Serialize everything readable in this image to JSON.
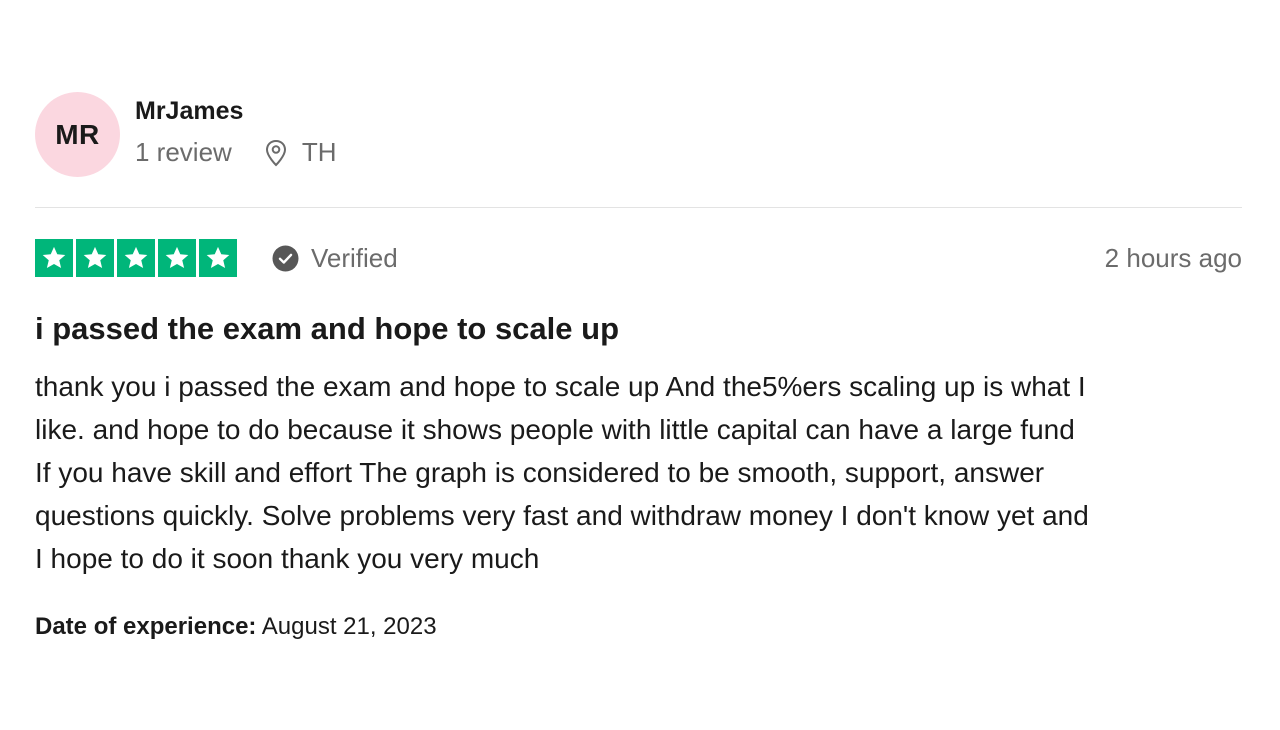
{
  "reviewer": {
    "initials": "MR",
    "avatar_color": "#fbd7e0",
    "name": "MrJames",
    "review_count": "1 review",
    "location_icon": "location-pin-icon",
    "country": "TH"
  },
  "review": {
    "rating": 5,
    "max_rating": 5,
    "star_color": "#00b67a",
    "verified_icon": "check-circle-icon",
    "verified_label": "Verified",
    "posted": "2 hours ago",
    "title": "i passed the exam and hope to scale up",
    "lines": [
      "thank you i passed the exam and hope to scale up And the5%ers scaling up is what I",
      "like. and hope to do because it shows people with little capital can have a large fund",
      "If you have skill and effort The graph is considered to be smooth, support, answer",
      "questions quickly. Solve problems very fast and withdraw money I don't know yet and",
      "I hope to do it soon thank you very much"
    ],
    "experience_label": "Date of experience:",
    "experience_date": "August 21, 2023"
  }
}
